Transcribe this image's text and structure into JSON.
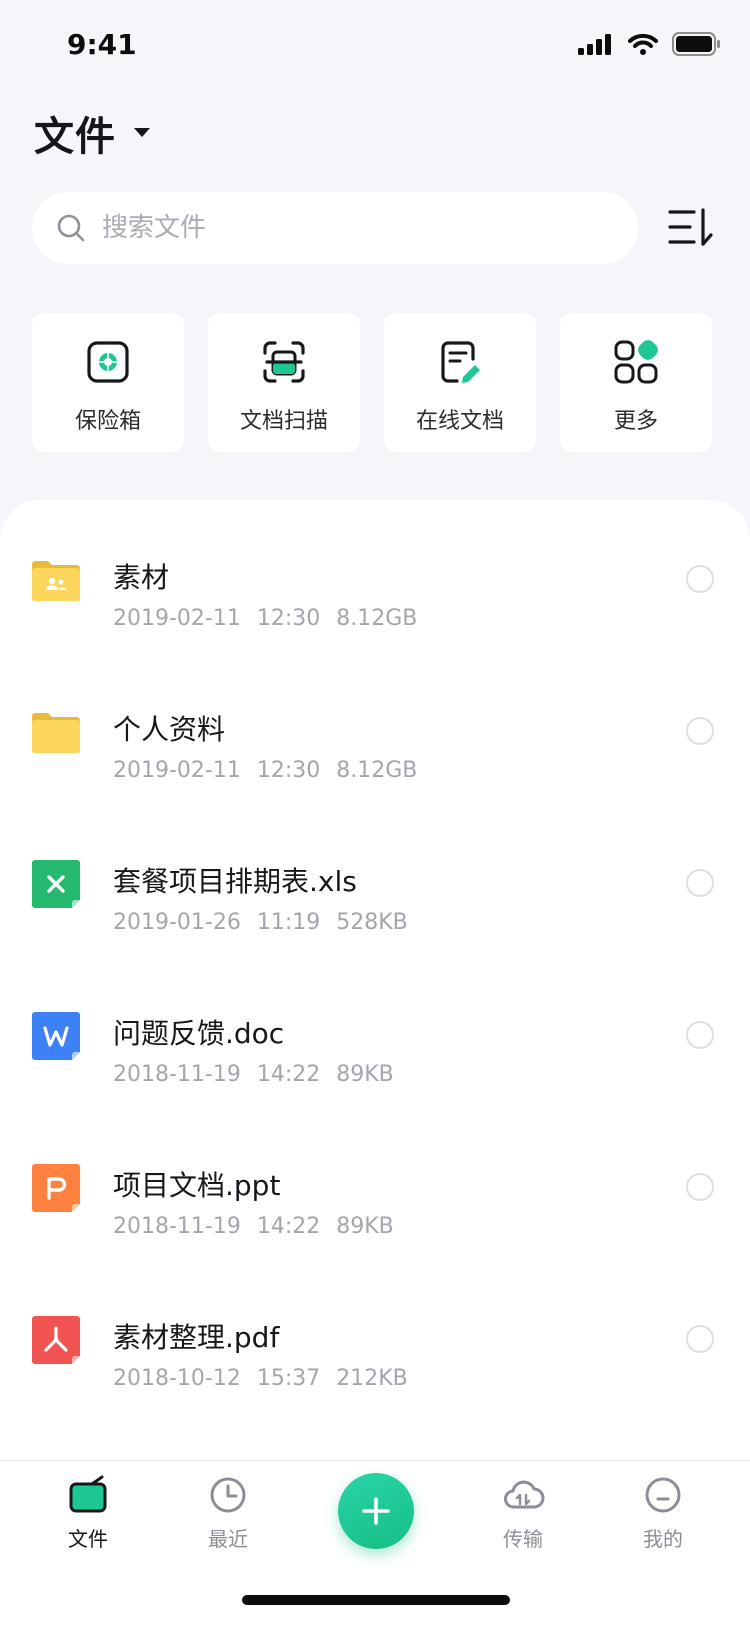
{
  "status_bar": {
    "time": "9:41"
  },
  "header": {
    "title": "文件"
  },
  "search": {
    "placeholder": "搜索文件"
  },
  "quick_actions": [
    {
      "label": "保险箱",
      "icon": "safe-box-icon"
    },
    {
      "label": "文档扫描",
      "icon": "scan-icon"
    },
    {
      "label": "在线文档",
      "icon": "online-doc-icon"
    },
    {
      "label": "更多",
      "icon": "more-grid-icon"
    }
  ],
  "files": [
    {
      "name": "素材",
      "date": "2019-02-11",
      "time": "12:30",
      "size": "8.12GB",
      "type": "shared-folder"
    },
    {
      "name": "个人资料",
      "date": "2019-02-11",
      "time": "12:30",
      "size": "8.12GB",
      "type": "folder"
    },
    {
      "name": "套餐项目排期表.xls",
      "date": "2019-01-26",
      "time": "11:19",
      "size": "528KB",
      "type": "xls"
    },
    {
      "name": "问题反馈.doc",
      "date": "2018-11-19",
      "time": "14:22",
      "size": "89KB",
      "type": "doc"
    },
    {
      "name": "项目文档.ppt",
      "date": "2018-11-19",
      "time": "14:22",
      "size": "89KB",
      "type": "ppt"
    },
    {
      "name": "素材整理.pdf",
      "date": "2018-10-12",
      "time": "15:37",
      "size": "212KB",
      "type": "pdf"
    }
  ],
  "tabs": [
    {
      "label": "文件",
      "icon": "folder-tab-icon",
      "active": true
    },
    {
      "label": "最近",
      "icon": "clock-icon",
      "active": false
    },
    {
      "label": "传输",
      "icon": "cloud-transfer-icon",
      "active": false
    },
    {
      "label": "我的",
      "icon": "profile-icon",
      "active": false
    }
  ],
  "colors": {
    "accent": "#1fc795",
    "folder": "#fcd55b",
    "xls": "#25b96f",
    "doc": "#3c82f6",
    "ppt": "#ff8140",
    "pdf": "#f25454"
  }
}
